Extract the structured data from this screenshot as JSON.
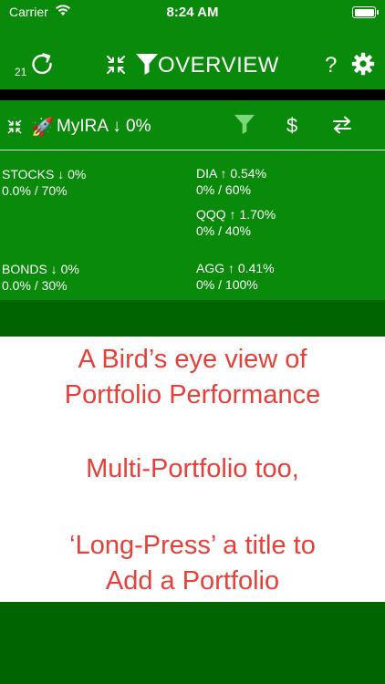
{
  "status_bar": {
    "carrier": "Carrier",
    "time": "8:24 AM"
  },
  "nav": {
    "refresh_count": "21",
    "title": "OVERVIEW",
    "help": "?"
  },
  "portfolio": {
    "emoji": "🚀",
    "name": "MyIRA ↓ 0%",
    "dollar": "$"
  },
  "holdings": {
    "left": [
      {
        "title": "STOCKS ↓ 0%",
        "alloc": "0.0% / 70%"
      },
      {
        "title": "BONDS ↓ 0%",
        "alloc": "0.0% / 30%"
      }
    ],
    "right": [
      {
        "title": "DIA ↑ 0.54%",
        "alloc": "0% / 60%"
      },
      {
        "title": "QQQ ↑ 1.70%",
        "alloc": "0% / 40%"
      },
      {
        "title": "AGG ↑ 0.41%",
        "alloc": "0% / 100%"
      }
    ]
  },
  "promo": {
    "line1": "A Bird’s eye view of",
    "line2": "Portfolio Performance",
    "line3": "Multi-Portfolio too,",
    "line4": "‘Long-Press’ a title to",
    "line5": "Add a Portfolio"
  },
  "colors": {
    "green_primary": "#0a8a0a",
    "green_dark": "#006400",
    "promo_text": "#e5403a"
  }
}
